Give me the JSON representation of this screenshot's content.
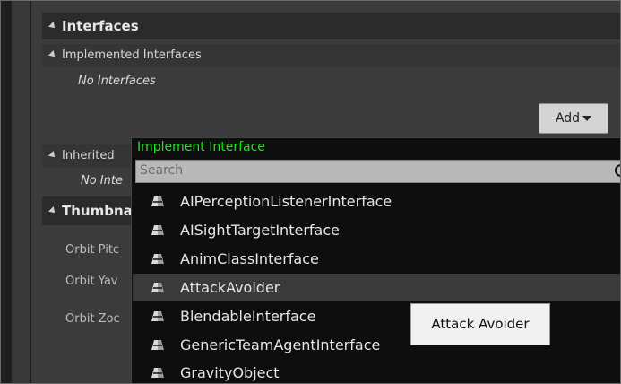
{
  "panel": {
    "interfaces_header": "Interfaces",
    "implemented_header": "Implemented Interfaces",
    "implemented_empty": "No Interfaces",
    "add_button": "Add",
    "inherited_header": "Inherited",
    "inherited_empty": "No Inte",
    "thumbnail_header": "Thumbna",
    "rows": [
      {
        "label": "Orbit Pitc"
      },
      {
        "label": "Orbit Yav"
      },
      {
        "label": "Orbit Zoc"
      }
    ]
  },
  "popup": {
    "title": "Implement Interface",
    "search_placeholder": "Search",
    "items": [
      {
        "label": "AIPerceptionListenerInterface",
        "highlighted": false
      },
      {
        "label": "AISightTargetInterface",
        "highlighted": false
      },
      {
        "label": "AnimClassInterface",
        "highlighted": false
      },
      {
        "label": "AttackAvoider",
        "highlighted": true
      },
      {
        "label": "BlendableInterface",
        "highlighted": false
      },
      {
        "label": "GenericTeamAgentInterface",
        "highlighted": false
      },
      {
        "label": "GravityObject",
        "highlighted": false
      }
    ]
  },
  "tooltip": {
    "text": "Attack Avoider"
  },
  "colors": {
    "title_green": "#1ee81e",
    "popup_bg": "#0e0e0e",
    "panel_bg": "#3b3b3b"
  },
  "icons": {
    "interface_item": "interface-icon",
    "search": "search-icon"
  }
}
